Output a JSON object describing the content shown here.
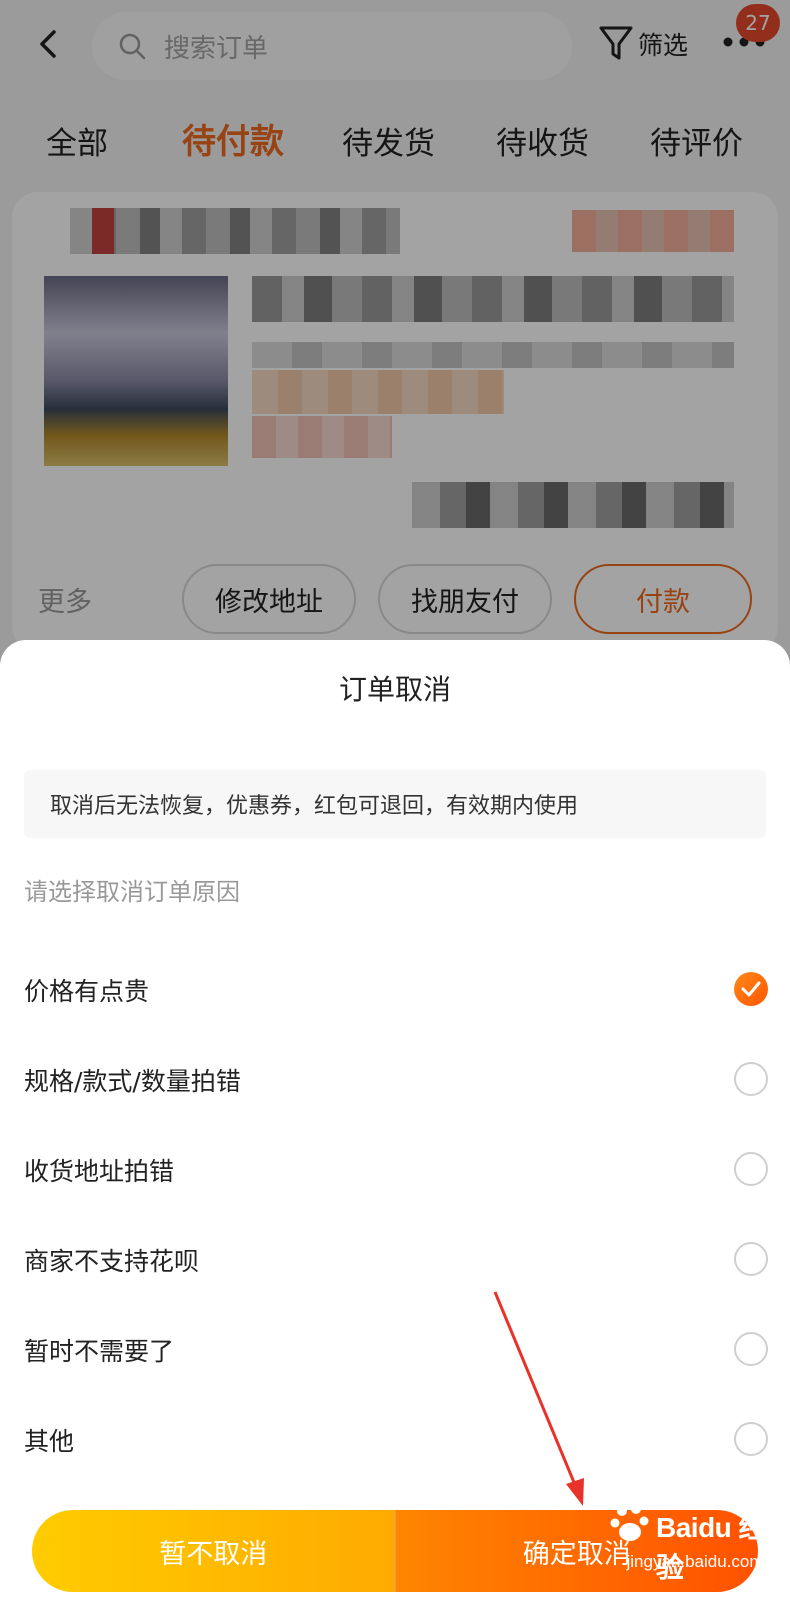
{
  "header": {
    "search_placeholder": "搜索订单",
    "filter_label": "筛选",
    "badge_count": "27"
  },
  "tabs": [
    {
      "label": "全部",
      "active": false
    },
    {
      "label": "待付款",
      "active": true
    },
    {
      "label": "待发货",
      "active": false
    },
    {
      "label": "待收货",
      "active": false
    },
    {
      "label": "待评价",
      "active": false
    }
  ],
  "order_card": {
    "more_label": "更多",
    "buttons": [
      {
        "label": "修改地址"
      },
      {
        "label": "找朋友付"
      },
      {
        "label": "付款"
      }
    ]
  },
  "cancel_sheet": {
    "title": "订单取消",
    "notice": "取消后无法恢复，优惠券，红包可退回，有效期内使用",
    "prompt": "请选择取消订单原因",
    "reasons": [
      {
        "label": "价格有点贵",
        "selected": true
      },
      {
        "label": "规格/款式/数量拍错",
        "selected": false
      },
      {
        "label": "收货地址拍错",
        "selected": false
      },
      {
        "label": "商家不支持花呗",
        "selected": false
      },
      {
        "label": "暂时不需要了",
        "selected": false
      },
      {
        "label": "其他",
        "selected": false
      }
    ],
    "keep_label": "暂不取消",
    "confirm_label": "确定取消"
  },
  "watermark": {
    "brand": "Baidu 经验",
    "url": "jingyan.baidu.com"
  },
  "colors": {
    "accent": "#ec6a1f",
    "keep_gradient_start": "#ffcc00",
    "confirm_gradient_end": "#ff5100",
    "annotation_arrow": "#e8322a"
  }
}
